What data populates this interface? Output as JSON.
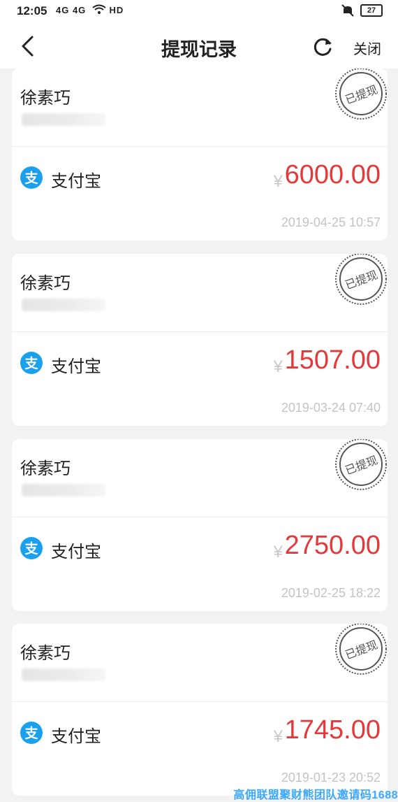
{
  "status_bar": {
    "time": "12:05",
    "network": "4G 4G",
    "hd": "HD",
    "battery": "27"
  },
  "header": {
    "title": "提现记录",
    "close_label": "关闭"
  },
  "records": [
    {
      "name": "徐素巧",
      "method": "支付宝",
      "currency": "¥",
      "amount": "6000.00",
      "datetime": "2019-04-25 10:57",
      "stamp": "已提现"
    },
    {
      "name": "徐素巧",
      "method": "支付宝",
      "currency": "¥",
      "amount": "1507.00",
      "datetime": "2019-03-24 07:40",
      "stamp": "已提现"
    },
    {
      "name": "徐素巧",
      "method": "支付宝",
      "currency": "¥",
      "amount": "2750.00",
      "datetime": "2019-02-25 18:22",
      "stamp": "已提现"
    },
    {
      "name": "徐素巧",
      "method": "支付宝",
      "currency": "¥",
      "amount": "1745.00",
      "datetime": "2019-01-23 20:52",
      "stamp": "已提现"
    }
  ],
  "watermark": "高佣联盟聚财熊团队邀请码1688",
  "colors": {
    "amount": "#e5383b",
    "alipay": "#1aa0ec",
    "stamp": "#555555"
  }
}
